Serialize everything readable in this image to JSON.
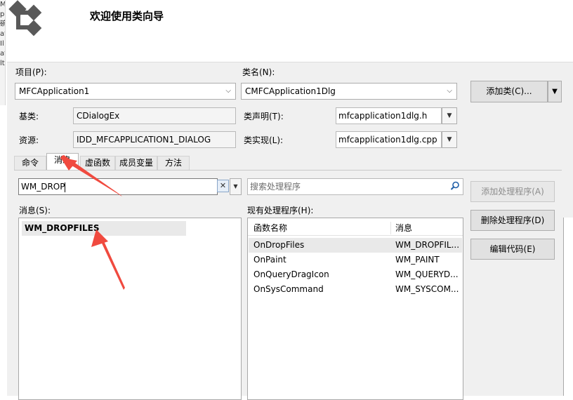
{
  "header": {
    "title": "欢迎使用类向导",
    "icon": "class-wizard-icon"
  },
  "left_fragment": [
    "M",
    "p",
    "碗",
    "at",
    "Il",
    "at",
    "lt"
  ],
  "project": {
    "label": "项目(P):",
    "value": "MFCApplication1"
  },
  "class_name": {
    "label": "类名(N):",
    "value": "CMFCApplication1Dlg"
  },
  "add_class_button": "添加类(C)...",
  "base_class": {
    "label": "基类:",
    "value": "CDialogEx"
  },
  "resource": {
    "label": "资源:",
    "value": "IDD_MFCAPPLICATION1_DIALOG"
  },
  "class_declaration": {
    "label": "类声明(T):",
    "value": "mfcapplication1dlg.h"
  },
  "class_implementation": {
    "label": "类实现(L):",
    "value": "mfcapplication1dlg.cpp"
  },
  "tabs": [
    {
      "label": "命令",
      "active": false
    },
    {
      "label": "消息",
      "active": true
    },
    {
      "label": "虚函数",
      "active": false
    },
    {
      "label": "成员变量",
      "active": false
    },
    {
      "label": "方法",
      "active": false
    }
  ],
  "message_filter": {
    "value": "WM_DROP",
    "clear_icon": "close-icon"
  },
  "handler_search": {
    "placeholder": "搜索处理程序",
    "icon": "search-icon"
  },
  "messages": {
    "label": "消息(S):",
    "items": [
      "WM_DROPFILES"
    ]
  },
  "existing_handlers": {
    "label": "现有处理程序(H):",
    "columns": [
      "函数名称",
      "消息"
    ],
    "rows": [
      {
        "function": "OnDropFiles",
        "message": "WM_DROPFIL..."
      },
      {
        "function": "OnPaint",
        "message": "WM_PAINT"
      },
      {
        "function": "OnQueryDragIcon",
        "message": "WM_QUERYD..."
      },
      {
        "function": "OnSysCommand",
        "message": "WM_SYSCOM..."
      }
    ]
  },
  "buttons": {
    "add_handler": "添加处理程序(A)",
    "delete_handler": "删除处理程序(D)",
    "edit_code": "编辑代码(E)"
  },
  "colors": {
    "annotation_arrow": "#f04a3f",
    "background": "#f0f0f0"
  }
}
